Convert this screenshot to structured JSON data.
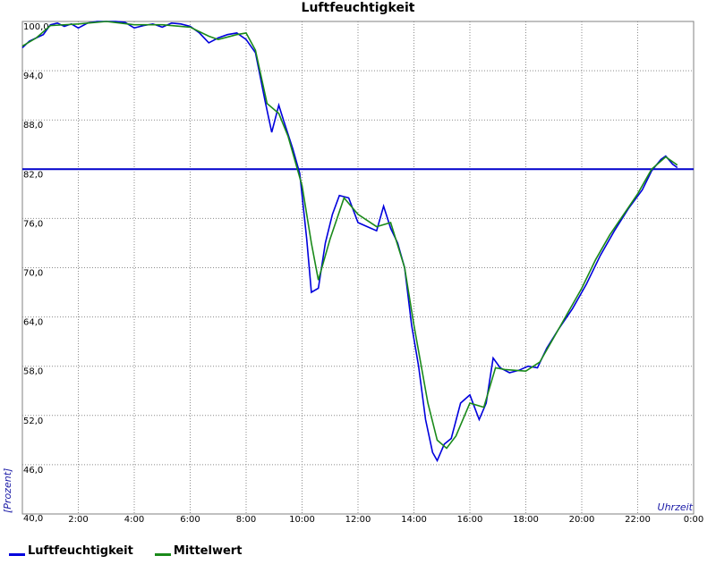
{
  "chart_data": {
    "type": "line",
    "title": "Luftfeuchtigkeit",
    "ylabel": "[Prozent]",
    "xlabel": "Uhrzeit",
    "ylim": [
      40,
      100
    ],
    "y_ticks": [
      "40,0",
      "46,0",
      "52,0",
      "58,0",
      "64,0",
      "70,0",
      "76,0",
      "82,0",
      "88,0",
      "94,0",
      "100,0"
    ],
    "x_ticks": [
      "2:00",
      "4:00",
      "6:00",
      "8:00",
      "10:00",
      "12:00",
      "14:00",
      "16:00",
      "18:00",
      "20:00",
      "22:00",
      "0:00"
    ],
    "grid": true,
    "reference_line": {
      "value": 82,
      "color": "#0000cc"
    },
    "series": [
      {
        "name": "Luftfeuchtigkeit",
        "color": "#0000dd",
        "points": [
          [
            "0:00",
            96.8
          ],
          [
            "0:15",
            97.6
          ],
          [
            "0:30",
            98.0
          ],
          [
            "0:45",
            98.4
          ],
          [
            "1:00",
            99.6
          ],
          [
            "1:15",
            99.8
          ],
          [
            "1:30",
            99.4
          ],
          [
            "1:45",
            99.7
          ],
          [
            "2:00",
            99.2
          ],
          [
            "2:20",
            99.8
          ],
          [
            "2:40",
            100
          ],
          [
            "3:00",
            100
          ],
          [
            "3:20",
            100
          ],
          [
            "3:40",
            99.9
          ],
          [
            "4:00",
            99.2
          ],
          [
            "4:20",
            99.5
          ],
          [
            "4:40",
            99.7
          ],
          [
            "5:00",
            99.3
          ],
          [
            "5:20",
            99.8
          ],
          [
            "5:40",
            99.7
          ],
          [
            "6:00",
            99.4
          ],
          [
            "6:20",
            98.6
          ],
          [
            "6:40",
            97.4
          ],
          [
            "7:00",
            98.0
          ],
          [
            "7:20",
            98.4
          ],
          [
            "7:40",
            98.6
          ],
          [
            "8:00",
            97.8
          ],
          [
            "8:20",
            96.2
          ],
          [
            "8:40",
            90.5
          ],
          [
            "8:55",
            86.5
          ],
          [
            "9:10",
            89.8
          ],
          [
            "9:20",
            88.0
          ],
          [
            "9:40",
            84.5
          ],
          [
            "9:55",
            81.5
          ],
          [
            "10:10",
            73.5
          ],
          [
            "10:20",
            67.0
          ],
          [
            "10:35",
            67.5
          ],
          [
            "10:50",
            73.0
          ],
          [
            "11:05",
            76.5
          ],
          [
            "11:20",
            78.8
          ],
          [
            "11:40",
            78.5
          ],
          [
            "12:00",
            75.5
          ],
          [
            "12:20",
            75.0
          ],
          [
            "12:40",
            74.5
          ],
          [
            "12:55",
            77.5
          ],
          [
            "13:10",
            74.8
          ],
          [
            "13:25",
            73.0
          ],
          [
            "13:40",
            70.0
          ],
          [
            "13:55",
            63.0
          ],
          [
            "14:10",
            58.0
          ],
          [
            "14:25",
            51.5
          ],
          [
            "14:40",
            47.5
          ],
          [
            "14:50",
            46.5
          ],
          [
            "15:05",
            48.5
          ],
          [
            "15:20",
            49.2
          ],
          [
            "15:40",
            53.5
          ],
          [
            "16:00",
            54.5
          ],
          [
            "16:20",
            51.5
          ],
          [
            "16:35",
            53.5
          ],
          [
            "16:50",
            59.0
          ],
          [
            "17:05",
            57.8
          ],
          [
            "17:25",
            57.2
          ],
          [
            "17:45",
            57.5
          ],
          [
            "18:05",
            58.0
          ],
          [
            "18:25",
            57.8
          ],
          [
            "18:45",
            60.2
          ],
          [
            "19:10",
            62.5
          ],
          [
            "19:40",
            65.0
          ],
          [
            "20:10",
            68.0
          ],
          [
            "20:40",
            71.5
          ],
          [
            "21:10",
            74.5
          ],
          [
            "21:40",
            77.2
          ],
          [
            "22:10",
            79.5
          ],
          [
            "22:30",
            81.8
          ],
          [
            "22:50",
            83.2
          ],
          [
            "23:00",
            83.6
          ],
          [
            "23:15",
            82.6
          ],
          [
            "23:25",
            82.2
          ]
        ]
      },
      {
        "name": "Mittelwert",
        "color": "#1a8a1a",
        "points": [
          [
            "0:00",
            97.0
          ],
          [
            "0:30",
            98.0
          ],
          [
            "1:00",
            99.5
          ],
          [
            "2:00",
            99.7
          ],
          [
            "3:00",
            100
          ],
          [
            "4:00",
            99.6
          ],
          [
            "5:00",
            99.6
          ],
          [
            "6:00",
            99.3
          ],
          [
            "6:40",
            98.2
          ],
          [
            "7:00",
            97.8
          ],
          [
            "7:40",
            98.4
          ],
          [
            "8:00",
            98.6
          ],
          [
            "8:20",
            96.5
          ],
          [
            "8:45",
            90.0
          ],
          [
            "9:10",
            88.8
          ],
          [
            "9:30",
            86.0
          ],
          [
            "10:00",
            80.0
          ],
          [
            "10:20",
            73.0
          ],
          [
            "10:35",
            68.5
          ],
          [
            "11:00",
            73.5
          ],
          [
            "11:30",
            78.5
          ],
          [
            "12:00",
            76.5
          ],
          [
            "12:40",
            75.0
          ],
          [
            "13:10",
            75.5
          ],
          [
            "13:40",
            70.0
          ],
          [
            "14:00",
            63.0
          ],
          [
            "14:30",
            53.5
          ],
          [
            "14:50",
            49.0
          ],
          [
            "15:10",
            48.0
          ],
          [
            "15:30",
            49.5
          ],
          [
            "16:00",
            53.5
          ],
          [
            "16:30",
            53.0
          ],
          [
            "16:55",
            57.8
          ],
          [
            "17:15",
            57.6
          ],
          [
            "18:00",
            57.4
          ],
          [
            "18:30",
            58.5
          ],
          [
            "19:00",
            61.5
          ],
          [
            "19:30",
            64.5
          ],
          [
            "20:00",
            67.5
          ],
          [
            "20:30",
            71.0
          ],
          [
            "21:00",
            74.0
          ],
          [
            "21:30",
            76.5
          ],
          [
            "22:00",
            79.0
          ],
          [
            "22:30",
            82.0
          ],
          [
            "23:00",
            83.5
          ],
          [
            "23:25",
            82.5
          ]
        ]
      }
    ]
  }
}
